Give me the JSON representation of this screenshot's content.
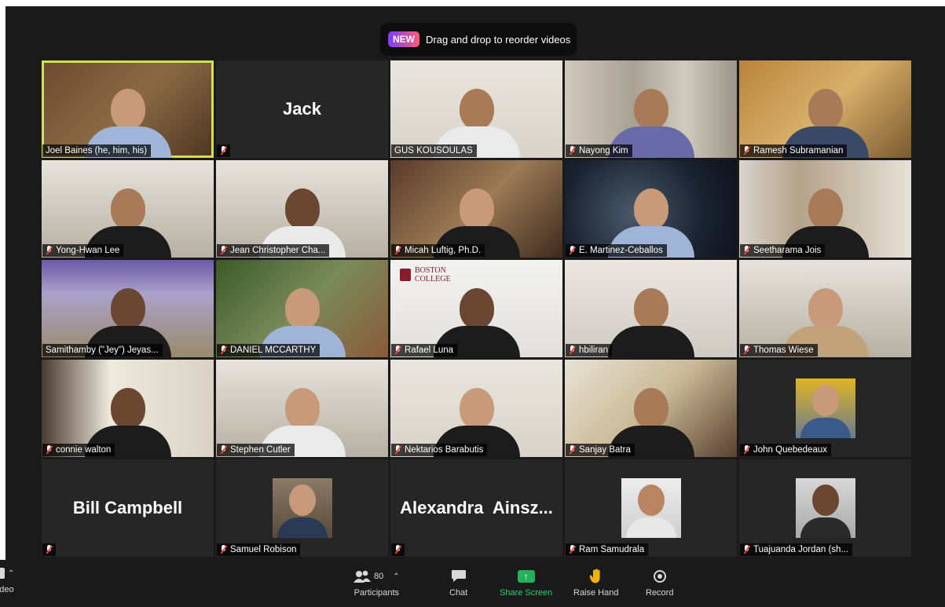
{
  "toast": {
    "badge": "NEW",
    "message": "Drag and drop to reorder videos"
  },
  "tiles": [
    {
      "name": "Joel Baines (he, him, his)",
      "active": true
    },
    {
      "name": "",
      "display_name": "Jack"
    },
    {
      "name": "GUS KOUSOULAS"
    },
    {
      "name": "Nayong Kim"
    },
    {
      "name": "Ramesh Subramanian"
    },
    {
      "name": "Yong-Hwan Lee"
    },
    {
      "name": "Jean Christopher Cha..."
    },
    {
      "name": "Micah Luftig, Ph.D."
    },
    {
      "name": "E. Martinez-Ceballos"
    },
    {
      "name": "Seetharama Jois"
    },
    {
      "name": "Samithamby (\"Jey\") Jeyas..."
    },
    {
      "name": "DANIEL MCCARTHY"
    },
    {
      "name": "Rafael Luna",
      "logo": "BOSTON COLLEGE"
    },
    {
      "name": "hbiliran"
    },
    {
      "name": "Thomas Wiese"
    },
    {
      "name": "connie walton"
    },
    {
      "name": "Stephen Cutler"
    },
    {
      "name": "Nektarios Barabutis"
    },
    {
      "name": "Sanjay Batra"
    },
    {
      "name": "John Quebedeaux"
    },
    {
      "name": "",
      "display_name": "Bill Campbell"
    },
    {
      "name": "Samuel Robison"
    },
    {
      "name": "",
      "display_name": "Alexandra  Ainsz..."
    },
    {
      "name": "Ram Samudrala"
    },
    {
      "name": "Tuajuanda Jordan (sh..."
    }
  ],
  "toolbar": {
    "video_label": "ideo",
    "participants_count": "80",
    "participants_label": "Participants",
    "chat_label": "Chat",
    "share_label": "Share Screen",
    "raise_hand_label": "Raise Hand",
    "record_label": "Record"
  },
  "colors": {
    "active_speaker": "#d6e04d",
    "share": "#23b15a",
    "muted_mic": "#e8463c"
  }
}
